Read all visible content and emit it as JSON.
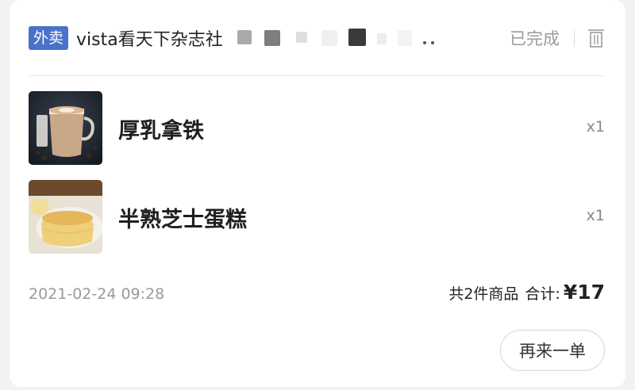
{
  "order": {
    "tag": "外卖",
    "shop_name": "vista看天下杂志社",
    "status": "已完成",
    "items": [
      {
        "name": "厚乳拿铁",
        "qty": "x1",
        "image": "latte-photo"
      },
      {
        "name": "半熟芝士蛋糕",
        "qty": "x1",
        "image": "cheesecake-photo"
      }
    ],
    "time": "2021-02-24 09:28",
    "count_text": "共2件商品",
    "total_label": "合计:",
    "total_price": "¥17",
    "reorder_label": "再来一单"
  },
  "colors": {
    "tag_bg": "#4a72c9",
    "muted_text": "#9b9b9b"
  },
  "icons": [
    "trash-icon"
  ]
}
